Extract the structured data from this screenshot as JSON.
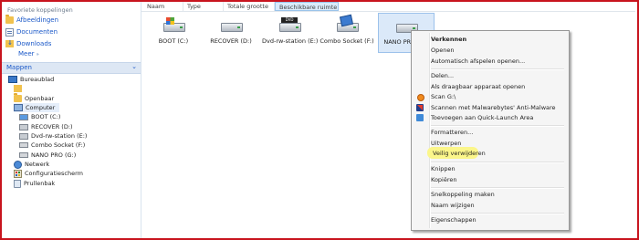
{
  "nav": {
    "favorites_header": "Favoriete koppelingen",
    "favorites": [
      {
        "label": "Afbeeldingen",
        "icon": "pictures-folder-icon"
      },
      {
        "label": "Documenten",
        "icon": "documents-folder-icon"
      },
      {
        "label": "Downloads",
        "icon": "downloads-folder-icon"
      }
    ],
    "more_label": "Meer",
    "more_arrow": "»",
    "folders_label": "Mappen",
    "folders_chevron": "⌄",
    "tree": [
      {
        "label": "Bureaublad",
        "icon": "desktop-icon"
      },
      {
        "label": "",
        "icon": "user-folder-icon"
      },
      {
        "label": "Openbaar",
        "icon": "public-folder-icon"
      },
      {
        "label": "Computer",
        "icon": "computer-icon"
      },
      {
        "label": "BOOT (C:)",
        "icon": "boot-drive-icon"
      },
      {
        "label": "RECOVER (D:)",
        "icon": "recover-drive-icon"
      },
      {
        "label": "Dvd-rw-station (E:)",
        "icon": "dvd-drive-icon"
      },
      {
        "label": "Combo Socket (F:)",
        "icon": "card-reader-icon"
      },
      {
        "label": "NANO PRO (G:)",
        "icon": "usb-drive-icon"
      },
      {
        "label": "Netwerk",
        "icon": "network-icon"
      },
      {
        "label": "Configuratiescherm",
        "icon": "control-panel-icon"
      },
      {
        "label": "Prullenbak",
        "icon": "recycle-bin-icon"
      }
    ]
  },
  "columns": [
    "Naam",
    "Type",
    "Totale grootte",
    "Beschikbare ruimte"
  ],
  "drives": [
    {
      "label": "BOOT (C:)"
    },
    {
      "label": "RECOVER (D:)"
    },
    {
      "label": "Dvd-rw-station (E:)"
    },
    {
      "label": "Combo Socket (F:)"
    },
    {
      "label": "NANO PRO (G:)"
    }
  ],
  "menu": {
    "items": [
      "Verkennen",
      "Openen",
      "Automatisch afspelen openen...",
      "Delen...",
      "Als draagbaar apparaat openen",
      "Scan G:\\",
      "Scannen met Malwarebytes' Anti-Malware",
      "Toevoegen aan Quick-Launch Area",
      "Formatteren...",
      "Uitwerpen",
      "Veilig verwijderen",
      "Knippen",
      "Kopiëren",
      "Snelkoppeling maken",
      "Naam wijzigen",
      "Eigenschappen"
    ]
  },
  "colors": {
    "frame_border": "#c8141e",
    "highlight": "#fbf68a",
    "link_blue": "#1a58c8"
  }
}
